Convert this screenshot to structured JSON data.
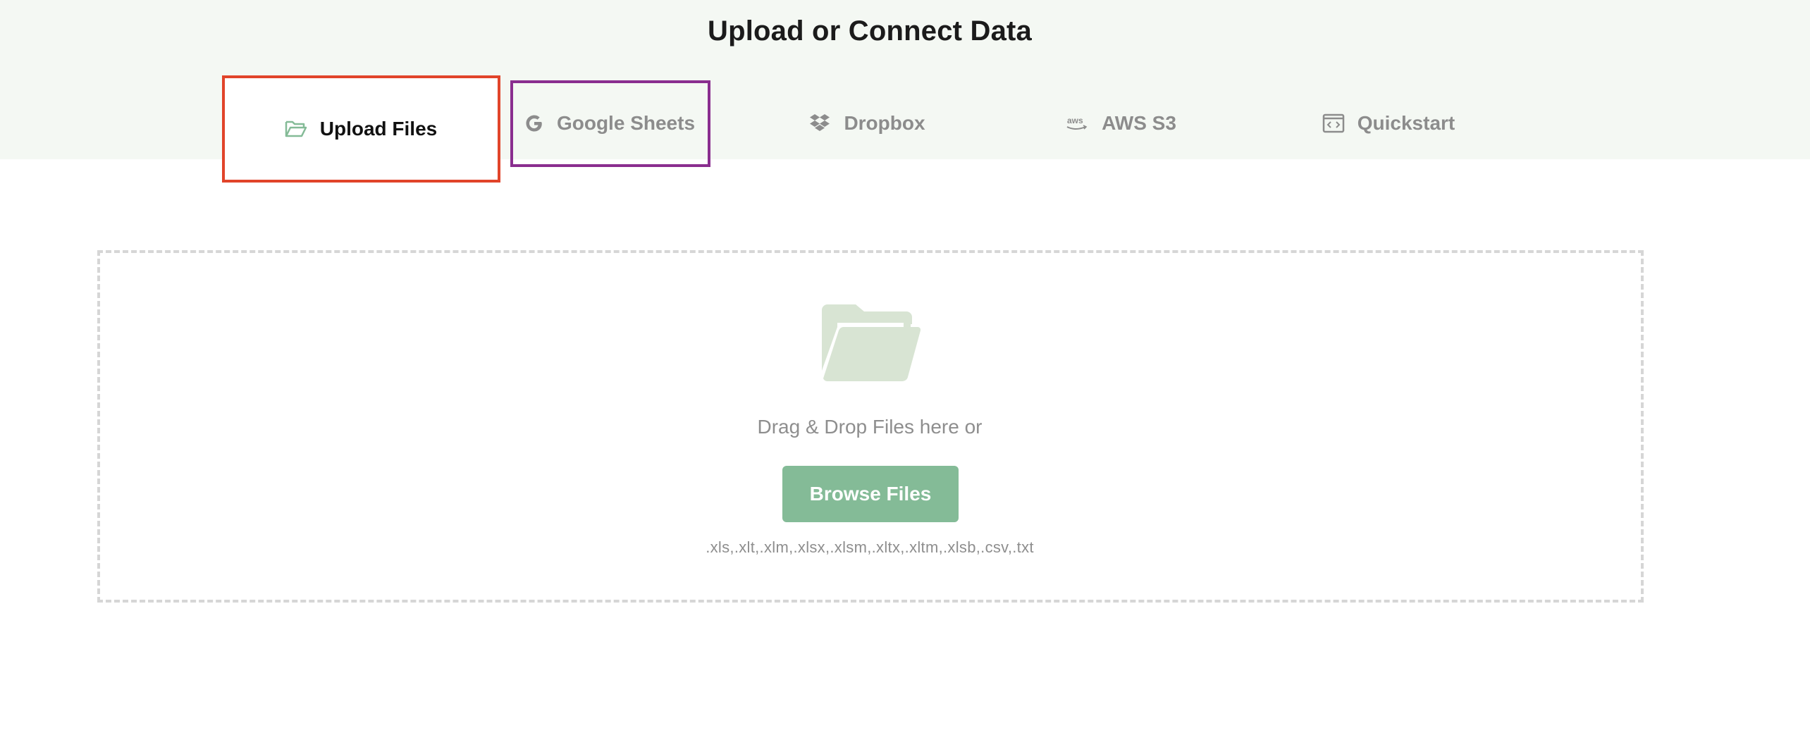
{
  "header": {
    "title": "Upload or Connect Data"
  },
  "tabs": [
    {
      "id": "upload",
      "label": "Upload Files",
      "icon": "folder-open-icon",
      "active": true
    },
    {
      "id": "sheets",
      "label": "Google Sheets",
      "icon": "google-icon",
      "active": false
    },
    {
      "id": "dropbox",
      "label": "Dropbox",
      "icon": "dropbox-icon",
      "active": false
    },
    {
      "id": "aws",
      "label": "AWS S3",
      "icon": "aws-icon",
      "active": false
    },
    {
      "id": "quickstart",
      "label": "Quickstart",
      "icon": "code-icon",
      "active": false
    }
  ],
  "dropzone": {
    "prompt": "Drag & Drop Files here or",
    "browse_label": "Browse Files",
    "accepted_extensions": ".xls,.xlt,.xlm,.xlsx,.xlsm,.xltx,.xltm,.xlsb,.csv,.txt"
  },
  "colors": {
    "top_band": "#f4f8f3",
    "accent_green": "#84bb97",
    "folder_placeholder": "#d8e4d3",
    "highlight_red": "#e1442a",
    "highlight_purple": "#8a2e8f",
    "inactive_text": "#8c8c8c"
  }
}
